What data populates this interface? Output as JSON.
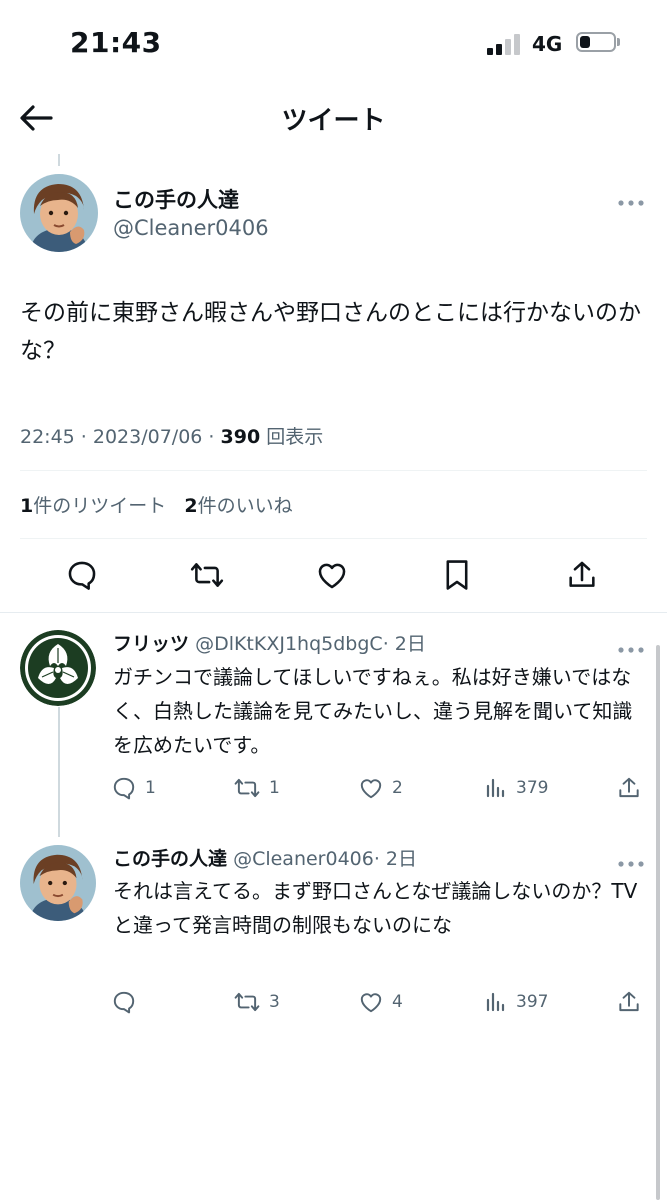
{
  "status_bar": {
    "time": "21:43",
    "network": "4G",
    "battery_level": 0.3
  },
  "header": {
    "title": "ツイート"
  },
  "main_tweet": {
    "display_name": "この手の人達",
    "handle": "@Cleaner0406",
    "text": "その前に東野さん暇さんや野口さんのとこには行かないのかな？",
    "timestamp": "22:45 · 2023/07/06 · ",
    "views_count": "390",
    "views_label": "回表示",
    "retweets_count": "1",
    "retweets_label": "件のリツイート",
    "likes_count": "2",
    "likes_label": "件のいいね"
  },
  "replies": [
    {
      "display_name": "フリッツ",
      "handle": "@DlKtKXJ1hq5dbgC",
      "age": "· 2日",
      "text": "ガチンコで議論してほしいですねぇ。私は好き嫌いではなく、白熱した議論を見てみたいし、違う見解を聞いて知識を広めたいです。",
      "reply_count": "1",
      "retweet_count": "1",
      "like_count": "2",
      "view_count": "379"
    },
    {
      "display_name": "この手の人達",
      "handle": "@Cleaner0406",
      "age": "· 2日",
      "text": "それは言えてる。まず野口さんとなぜ議論しないのか？TVと違って発言時間の制限もないのにな",
      "reply_count": "",
      "retweet_count": "3",
      "like_count": "4",
      "view_count": "397"
    }
  ],
  "colors": {
    "text": "#0f1419",
    "secondary": "#536471",
    "divider": "#eff3f4"
  }
}
